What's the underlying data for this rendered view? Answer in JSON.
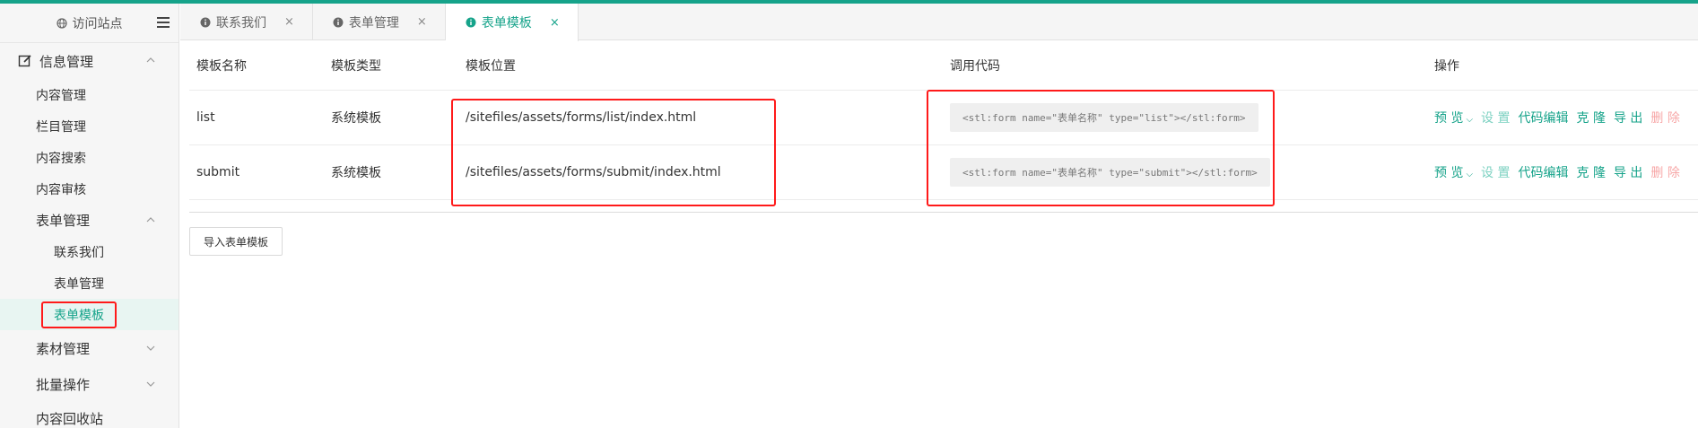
{
  "sidebar": {
    "visit_label": "访问站点",
    "groups": [
      {
        "label": "信息管理",
        "expanded": true
      }
    ],
    "items": [
      {
        "label": "内容管理"
      },
      {
        "label": "栏目管理"
      },
      {
        "label": "内容搜索"
      },
      {
        "label": "内容审核"
      }
    ],
    "form_group": {
      "label": "表单管理",
      "expanded": true
    },
    "form_subitems": [
      {
        "label": "联系我们"
      },
      {
        "label": "表单管理"
      },
      {
        "label": "表单模板",
        "active": true
      }
    ],
    "after": [
      {
        "label": "素材管理",
        "expandable": true
      },
      {
        "label": "批量操作",
        "expandable": true
      },
      {
        "label": "内容回收站",
        "expandable": false
      }
    ]
  },
  "tabs": [
    {
      "label": "联系我们",
      "close": "×"
    },
    {
      "label": "表单管理",
      "close": "×"
    },
    {
      "label": "表单模板",
      "close": "×",
      "active": true
    }
  ],
  "table": {
    "headers": [
      "模板名称",
      "模板类型",
      "模板位置",
      "调用代码",
      "操作"
    ],
    "rows": [
      {
        "name": "list",
        "type": "系统模板",
        "location": "/sitefiles/assets/forms/list/index.html",
        "code": "<stl:form name=\"表单名称\" type=\"list\"></stl:form>"
      },
      {
        "name": "submit",
        "type": "系统模板",
        "location": "/sitefiles/assets/forms/submit/index.html",
        "code": "<stl:form name=\"表单名称\" type=\"submit\"></stl:form>"
      }
    ],
    "actions": {
      "preview": "预 览",
      "settings": "设 置",
      "code_edit": "代码编辑",
      "clone": "克 隆",
      "export": "导 出",
      "delete": "删 除"
    }
  },
  "import_button": "导入表单模板",
  "colors": {
    "accent": "#16a38a",
    "highlight_border": "#ff1a1a"
  }
}
